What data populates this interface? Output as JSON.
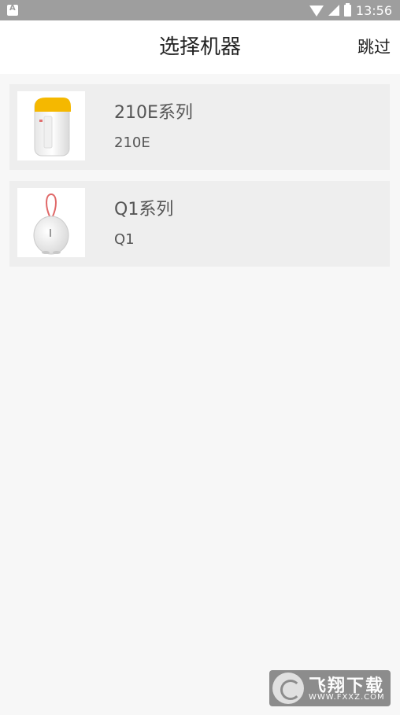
{
  "status_bar": {
    "app_icon": "A",
    "time": "13:56",
    "icons": [
      "wifi-icon",
      "signal-icon",
      "battery-icon"
    ]
  },
  "header": {
    "title": "选择机器",
    "skip_label": "跳过"
  },
  "devices": [
    {
      "series": "210E系列",
      "model": "210E",
      "image": "label-printer-210e-image"
    },
    {
      "series": "Q1系列",
      "model": "Q1",
      "image": "egg-printer-q1-image"
    }
  ],
  "watermark": {
    "brand": "飞翔下载",
    "url": "WWW.FXXZ.COM"
  },
  "colors": {
    "status_bar": "#9e9e9e",
    "card_bg": "#eeeeee",
    "page_bg": "#f7f7f7",
    "printer_accent": "#f5b800"
  }
}
